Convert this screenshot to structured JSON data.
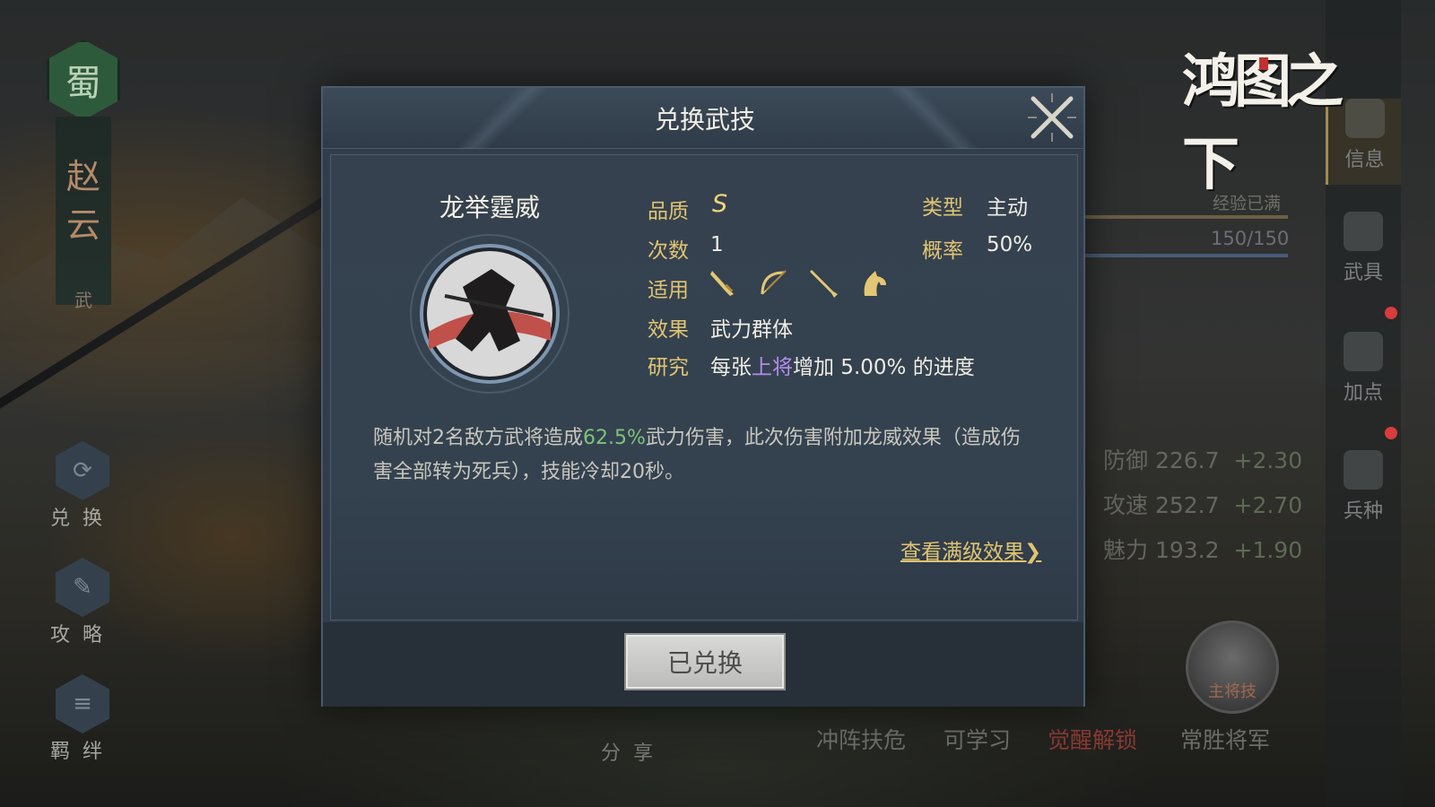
{
  "background": {
    "faction_badge": "蜀",
    "hero_name": [
      "赵",
      "云"
    ],
    "hero_sub": "武",
    "side_buttons": [
      {
        "label": "兑换",
        "icon": "exchange-icon"
      },
      {
        "label": "攻略",
        "icon": "scroll-icon"
      },
      {
        "label": "羁绊",
        "icon": "bond-icon"
      }
    ],
    "logo_text": "鸿图之下",
    "right_rail": [
      {
        "label": "信息",
        "icon": "info-icon"
      },
      {
        "label": "武具",
        "icon": "equipment-icon"
      },
      {
        "label": "加点",
        "icon": "add-points-icon"
      },
      {
        "label": "兵种",
        "icon": "troop-type-icon"
      }
    ],
    "exp_label": "经验已满",
    "exp_value": "150/150",
    "stats": [
      {
        "name": "防御",
        "value": "226.7",
        "bonus": "+2.30"
      },
      {
        "name": "攻速",
        "value": "252.7",
        "bonus": "+2.70"
      },
      {
        "name": "魅力",
        "value": "193.2",
        "bonus": "+1.90"
      }
    ],
    "skill_tabs": [
      "冲阵扶危",
      "可学习",
      "觉醒解锁",
      "常胜将军"
    ],
    "main_skill_caption": "主将技",
    "share_label": "分享",
    "colors": {
      "awaken_tab": "#8a3a34",
      "accent_gold": "#e0c472"
    }
  },
  "modal": {
    "title": "兑换武技",
    "skill_name": "龙举霆威",
    "labels": {
      "quality": "品质",
      "count": "次数",
      "applicable": "适用",
      "effect": "效果",
      "research": "研究",
      "type": "类型",
      "probability": "概率"
    },
    "quality_value": "S",
    "count_value": "1",
    "type_value": "主动",
    "probability_value": "50%",
    "applicable_icons": [
      "sword-icon",
      "bow-icon",
      "spear-icon",
      "horse-icon"
    ],
    "effect_value": "武力群体",
    "research": {
      "prefix": "每张",
      "highlight": "上将",
      "suffix": "增加 5.00% 的进度"
    },
    "description": {
      "part1": "随机对2名敌方武将造成",
      "highlight": "62.5%",
      "part2": "武力伤害，此次伤害附加龙威效果（造成伤害全部转为死兵），技能冷却20秒。"
    },
    "full_effect_link": "查看满级效果❯",
    "redeemed_button": "已兑换"
  }
}
